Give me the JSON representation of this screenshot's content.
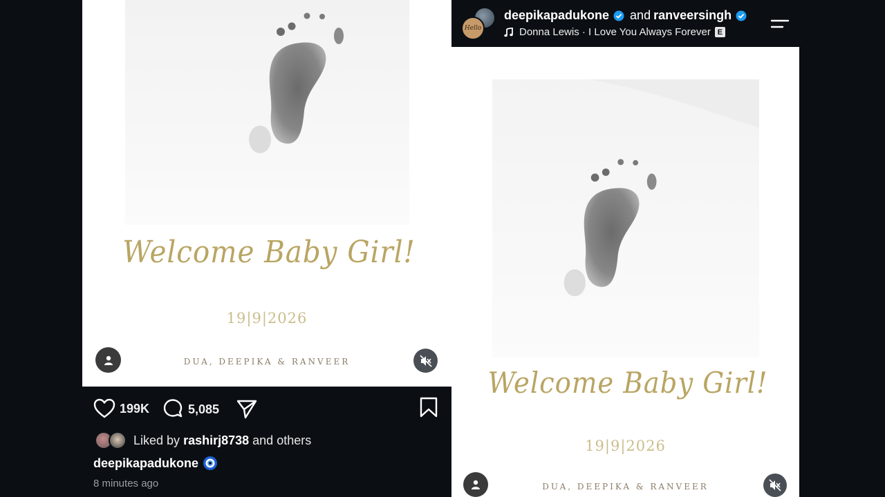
{
  "left_post": {
    "image": {
      "welcome_text": "Welcome Baby Girl!",
      "date_text": "19|9|2026",
      "names_text": "DUA, DEEPIKA & RANVEER",
      "tag_icon": "person-icon",
      "mute_icon": "speaker-muted-icon"
    },
    "actions": {
      "like_count": "199K",
      "comment_count": "5,085",
      "like_icon": "heart-icon",
      "comment_icon": "comment-bubble-icon",
      "share_icon": "send-icon",
      "save_icon": "bookmark-icon"
    },
    "liked_by": {
      "prefix": "Liked by",
      "username": "rashirj8738",
      "suffix": "and others"
    },
    "caption": {
      "username": "deepikapadukone",
      "emoji": "🧿"
    },
    "timestamp": "8 minutes ago"
  },
  "right_post": {
    "header": {
      "user1": "deepikapadukone",
      "connector": "and",
      "user2": "ranveersingh",
      "song": "Donna Lewis · I Love You Always Forever",
      "explicit_badge": "E",
      "avatar_text": "Hello"
    },
    "image": {
      "welcome_text": "Welcome Baby Girl!",
      "date_text": "19|9|2026",
      "names_text": "DUA, DEEPIKA & RANVEER"
    }
  },
  "colors": {
    "background": "#0b0f14",
    "gold": "#b9a563",
    "verified_blue": "#1d9bf0"
  }
}
